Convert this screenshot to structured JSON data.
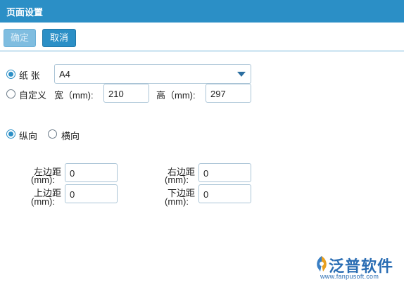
{
  "dialog": {
    "title": "页面设置"
  },
  "toolbar": {
    "ok_label": "确定",
    "cancel_label": "取消"
  },
  "paper": {
    "paper_option_label": "纸 张",
    "paper_size_value": "A4",
    "custom_option_label": "自定义",
    "width_label": "宽（mm):",
    "width_value": "210",
    "height_label": "高（mm):",
    "height_value": "297",
    "selected": "paper"
  },
  "orientation": {
    "portrait_label": "纵向",
    "landscape_label": "横向",
    "selected": "portrait"
  },
  "margins": {
    "left_label_1": "左边距",
    "left_label_2": "(mm):",
    "left_value": "0",
    "right_label_1": "右边距",
    "right_label_2": "(mm):",
    "right_value": "0",
    "top_label_1": "上边距",
    "top_label_2": "(mm):",
    "top_value": "0",
    "bottom_label_1": "下边距",
    "bottom_label_2": "(mm):",
    "bottom_value": "0"
  },
  "watermark": {
    "brand": "泛普软件",
    "url": "www.fanpusoft.com"
  },
  "colors": {
    "accent": "#2b8fc6",
    "brand": "#2a6db3"
  }
}
